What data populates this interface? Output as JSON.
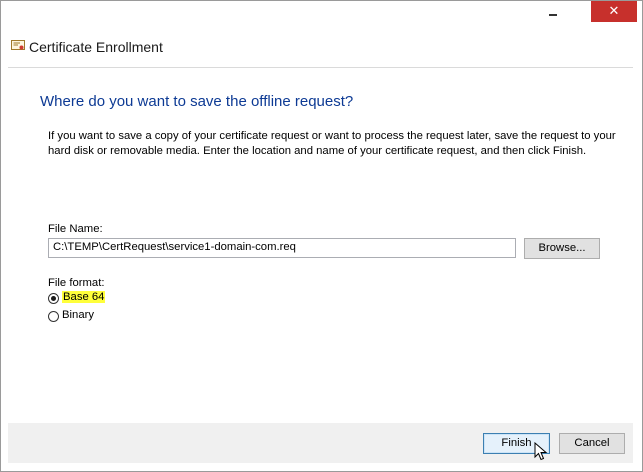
{
  "window": {
    "title": "Certificate Enrollment",
    "controls": {
      "minimize": "minimize",
      "close": "✕"
    }
  },
  "page": {
    "heading": "Where do you want to save the offline request?",
    "description": "If you want to save a copy of your certificate request or want to process the request later, save the request to your hard disk or removable media. Enter the location and name of your certificate request, and then click Finish."
  },
  "file": {
    "label": "File Name:",
    "value": "C:\\TEMP\\CertRequest\\service1-domain-com.req",
    "browse_label": "Browse..."
  },
  "format": {
    "label": "File format:",
    "options": [
      {
        "label": "Base 64",
        "selected": true,
        "highlighted": true
      },
      {
        "label": "Binary",
        "selected": false
      }
    ]
  },
  "footer": {
    "finish_label": "Finish",
    "cancel_label": "Cancel"
  },
  "colors": {
    "heading": "#0d3a94",
    "close_button": "#c7302c",
    "highlight": "#ffff3b"
  }
}
